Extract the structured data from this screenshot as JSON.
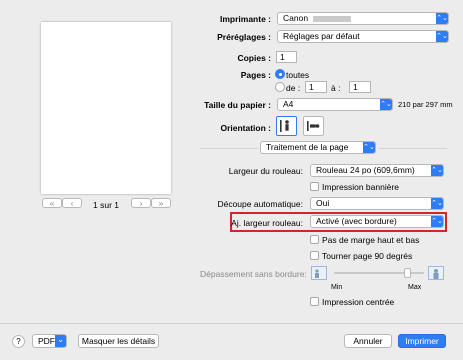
{
  "preview": {
    "page_indicator": "1 sur 1",
    "nav_first": "«",
    "nav_prev": "‹",
    "nav_next": "›",
    "nav_last": "»"
  },
  "printer": {
    "label": "Imprimante :",
    "value": "Canon"
  },
  "presets": {
    "label": "Préréglages :",
    "value": "Réglages par défaut"
  },
  "copies": {
    "label": "Copies :",
    "value": "1"
  },
  "pages": {
    "label": "Pages :",
    "all_label": "toutes",
    "from_label": "de :",
    "from_value": "1",
    "to_label": "à :",
    "to_value": "1"
  },
  "paper_size": {
    "label": "Taille du papier :",
    "value": "A4",
    "dimensions": "210 par 297 mm"
  },
  "orientation": {
    "label": "Orientation :"
  },
  "section": {
    "value": "Traitement de la page"
  },
  "roll_width": {
    "label": "Largeur du rouleau:",
    "value": "Rouleau 24 po (609,6mm)"
  },
  "banner": {
    "label": "Impression bannière"
  },
  "auto_cut": {
    "label": "Découpe automatique:",
    "value": "Oui"
  },
  "fit_roll": {
    "label": "Aj. largeur rouleau:",
    "value": "Activé (avec bordure)"
  },
  "no_margin": {
    "label": "Pas de marge haut et bas"
  },
  "rotate": {
    "label": "Tourner page 90 degrés"
  },
  "overflow": {
    "label": "Dépassement sans bordure:",
    "min_label": "Min",
    "max_label": "Max"
  },
  "centered": {
    "label": "Impression centrée"
  },
  "footer": {
    "help": "?",
    "pdf": "PDF",
    "hide_details": "Masquer les détails",
    "cancel": "Annuler",
    "print": "Imprimer"
  },
  "colors": {
    "accent": "#2f7df6",
    "highlight_border": "#d9232a"
  },
  "icons": {
    "popup_arrows": "⌃⌄",
    "chevron_down": "⌄"
  }
}
